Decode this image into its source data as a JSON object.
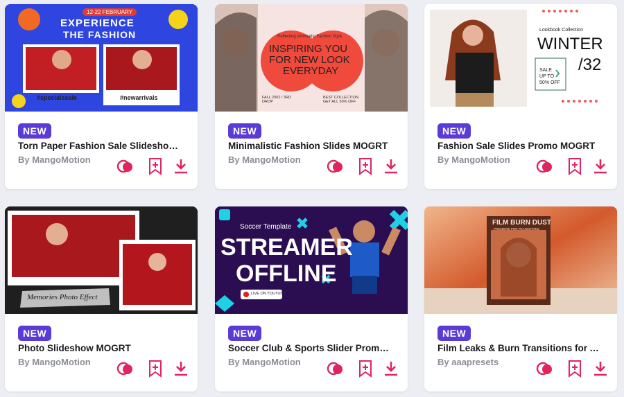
{
  "colors": {
    "badge": "#5b3bd6",
    "action": "#e0245e",
    "page_bg": "#eceef3"
  },
  "icons": {
    "preview": "overlapping-circles-icon",
    "bookmark": "bookmark-plus-icon",
    "download": "download-arrow-icon"
  },
  "cards": [
    {
      "badge": "NEW",
      "title": "Torn Paper Fashion Sale Slideshow ...",
      "author": "By MangoMotion",
      "thumb": {
        "date": "12-22 FEBRUARY",
        "headline1": "EXPERIENCE",
        "headline2": "THE FASHION",
        "tag1": "#specialssale",
        "tag2": "#newarrivals"
      }
    },
    {
      "badge": "NEW",
      "title": "Minimalistic Fashion Slides MOGRT",
      "author": "By MangoMotion",
      "thumb": {
        "small": "Reflecting minimalist Fashion Style",
        "line1": "INSPIRING YOU",
        "line2": "FOR NEW LOOK",
        "line3": "EVERYDAY",
        "left_note": "FALL 2002 / 3RD DROP",
        "right_note": "BEST COLLECTION GET ALL 50% OFF"
      }
    },
    {
      "badge": "NEW",
      "title": "Fashion Sale Slides Promo MOGRT",
      "author": "By MangoMotion",
      "thumb": {
        "small": "Lookbook Collection",
        "big": "WINTER",
        "number": "/32",
        "sale1": "SALE",
        "sale2": "UP TO",
        "sale3": "50% OFF"
      }
    },
    {
      "badge": "NEW",
      "title": "Photo Slideshow MOGRT",
      "author": "By MangoMotion",
      "thumb": {
        "label": "Memories Photo Effect"
      }
    },
    {
      "badge": "NEW",
      "title": "Soccer Club & Sports Slider Promo ...",
      "author": "By MangoMotion",
      "thumb": {
        "small": "Soccer Template",
        "big1": "STREAMER",
        "big2": "OFFLINE",
        "button": "LIVE ON YOUTUBE"
      }
    },
    {
      "badge": "NEW",
      "title": "Film Leaks & Burn Transitions for A...",
      "author": "By aaapresets",
      "thumb": {
        "box_title": "FILM BURN DUST",
        "box_sub": "PREMIERE PRO TRANSITIONS"
      }
    }
  ]
}
